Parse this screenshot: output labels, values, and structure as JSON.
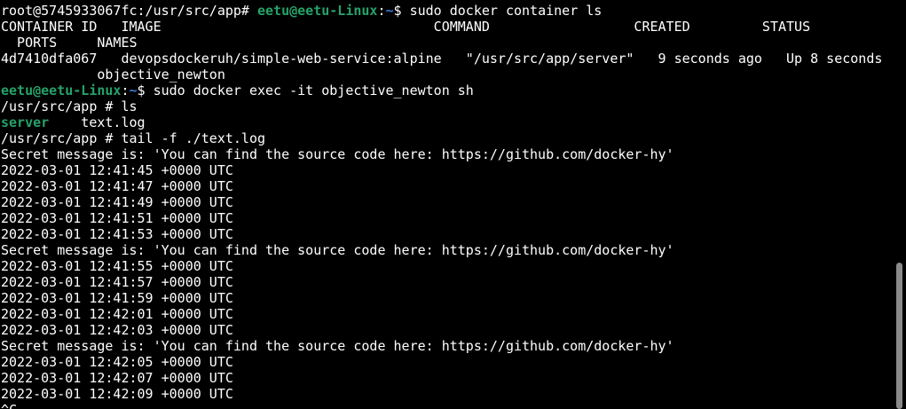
{
  "colors": {
    "background": "#000000",
    "foreground": "#ffffff",
    "prompt_user": "#26a269",
    "prompt_path": "#3a7bd5",
    "ls_directory": "#26a269"
  },
  "prompt1": {
    "prefix": "root@5745933067fc:/usr/src/app# ",
    "user_host": "eetu@eetu-Linux",
    "colon": ":",
    "path": "~",
    "dollar": "$ ",
    "command": "sudo docker container ls"
  },
  "table": {
    "header_line1": "CONTAINER ID   IMAGE                                  COMMAND                  CREATED         STATUS",
    "header_line2": "  PORTS     NAMES",
    "row_line1": "4d7410dfa067   devopsdockeruh/simple-web-service:alpine   \"/usr/src/app/server\"   9 seconds ago   Up 8 seconds",
    "row_line2": "            objective_newton"
  },
  "prompt2": {
    "user_host": "eetu@eetu-Linux",
    "colon": ":",
    "path": "~",
    "dollar": "$ ",
    "command": "sudo docker exec -it objective_newton sh"
  },
  "shell": {
    "ls_prompt": "/usr/src/app # ls",
    "ls_dir": "server",
    "ls_file": "    text.log",
    "tail_prompt": "/usr/src/app # tail -f ./text.log"
  },
  "log_lines": [
    "Secret message is: 'You can find the source code here: https://github.com/docker-hy'",
    "2022-03-01 12:41:45 +0000 UTC",
    "2022-03-01 12:41:47 +0000 UTC",
    "2022-03-01 12:41:49 +0000 UTC",
    "2022-03-01 12:41:51 +0000 UTC",
    "2022-03-01 12:41:53 +0000 UTC",
    "Secret message is: 'You can find the source code here: https://github.com/docker-hy'",
    "2022-03-01 12:41:55 +0000 UTC",
    "2022-03-01 12:41:57 +0000 UTC",
    "2022-03-01 12:41:59 +0000 UTC",
    "2022-03-01 12:42:01 +0000 UTC",
    "2022-03-01 12:42:03 +0000 UTC",
    "Secret message is: 'You can find the source code here: https://github.com/docker-hy'",
    "2022-03-01 12:42:05 +0000 UTC",
    "2022-03-01 12:42:07 +0000 UTC",
    "2022-03-01 12:42:09 +0000 UTC",
    "^C"
  ]
}
